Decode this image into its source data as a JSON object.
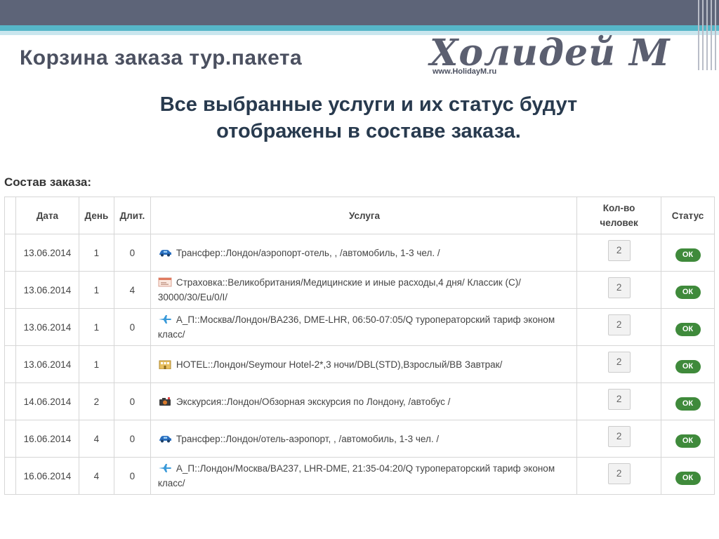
{
  "slide": {
    "title": "Корзина заказа тур.пакета",
    "subtitle_line1": "Все выбранные услуги и их статус будут",
    "subtitle_line2": "отображены в составе заказа."
  },
  "logo": {
    "text": "Холидей М",
    "url": "www.HolidayM.ru"
  },
  "order": {
    "section_title": "Состав заказа:",
    "columns": {
      "date": "Дата",
      "day": "День",
      "duration": "Длит.",
      "service": "Услуга",
      "qty_line1": "Кол-во",
      "qty_line2": "человек",
      "status": "Статус"
    },
    "rows": [
      {
        "date": "13.06.2014",
        "day": "1",
        "duration": "0",
        "icon": "car-icon",
        "service": "Трансфер::Лондон/аэропорт-отель, , /автомобиль, 1-3 чел. /",
        "qty": "2",
        "status": "ОК"
      },
      {
        "date": "13.06.2014",
        "day": "1",
        "duration": "4",
        "icon": "insurance-icon",
        "service": "Страховка::Великобритания/Медицинские и иные расходы,4 дня/ Классик (С)/ 30000/30/Eu/0/I/",
        "qty": "2",
        "status": "ОК"
      },
      {
        "date": "13.06.2014",
        "day": "1",
        "duration": "0",
        "icon": "plane-icon",
        "service": "А_П::Москва/Лондон/BA236, DME-LHR, 06:50-07:05/Q туроператорский тариф эконом класс/",
        "qty": "2",
        "status": "ОК"
      },
      {
        "date": "13.06.2014",
        "day": "1",
        "duration": "",
        "icon": "hotel-icon",
        "service": "HOTEL::Лондон/Seymour Hotel-2*,3 ночи/DBL(STD),Взрослый/BB Завтрак/",
        "qty": "2",
        "status": "ОК"
      },
      {
        "date": "14.06.2014",
        "day": "2",
        "duration": "0",
        "icon": "camera-icon",
        "service": "Экскурсия::Лондон/Обзорная экскурсия по Лондону, /автобус /",
        "qty": "2",
        "status": "ОК"
      },
      {
        "date": "16.06.2014",
        "day": "4",
        "duration": "0",
        "icon": "car-icon",
        "service": "Трансфер::Лондон/отель-аэропорт, , /автомобиль, 1-3 чел. /",
        "qty": "2",
        "status": "ОК"
      },
      {
        "date": "16.06.2014",
        "day": "4",
        "duration": "0",
        "icon": "plane-icon",
        "service": "А_П::Лондон/Москва/BA237, LHR-DME, 21:35-04:20/Q туроператорский тариф эконом класс/",
        "qty": "2",
        "status": "ОК"
      }
    ]
  },
  "colors": {
    "header_band": "#5d6478",
    "accent_band": "#56b6c8",
    "status_ok": "#3f8a3b",
    "subtitle_text": "#283a4e"
  }
}
